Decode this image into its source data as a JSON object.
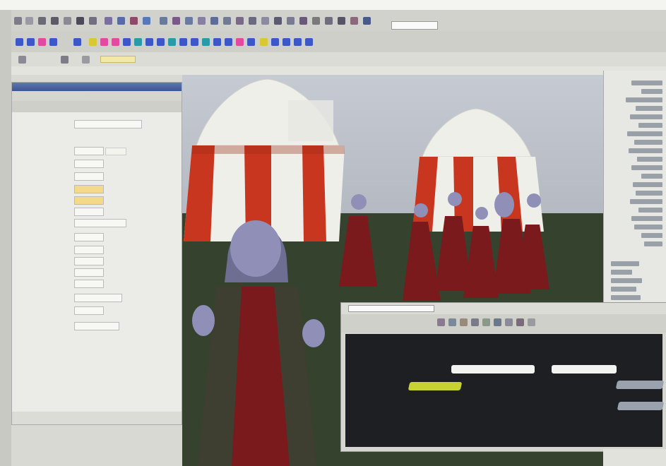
{
  "toolbar": {
    "icons": [
      "select-icon",
      "lasso-icon",
      "move-icon",
      "rotate-icon",
      "scale-icon",
      "soft-mod-icon",
      "show-manip-icon",
      "snap-grid-icon",
      "snap-curve-icon",
      "snap-point-icon",
      "snap-surface-icon",
      "history-icon",
      "render-icon",
      "ipr-icon",
      "render-settings-icon",
      "hypershade-icon"
    ],
    "shelf_icons": [
      "sphere-icon",
      "cube-icon",
      "cylinder-icon",
      "cone-icon",
      "plane-icon",
      "torus-icon",
      "nurbs-sphere-icon",
      "nurbs-cube-icon",
      "curve-icon",
      "paint-icon",
      "sculpt-icon",
      "joint-icon",
      "ik-icon",
      "skin-icon",
      "deformer-icon",
      "cloth-icon"
    ],
    "colors": {
      "shelf_blue": "#3c58c8",
      "shelf_pink": "#e24aa2",
      "shelf_teal": "#2b9aa8",
      "shelf_yellow": "#d9c833"
    }
  },
  "attribute_editor": {
    "accent": "#4a64a4",
    "rows": [
      {
        "label": "",
        "value": ""
      },
      {
        "label": "",
        "value": ""
      },
      {
        "label": "",
        "value": ""
      },
      {
        "label": "",
        "value": ""
      },
      {
        "label": "",
        "value": ""
      },
      {
        "label": "",
        "value": ""
      },
      {
        "label": "",
        "value": ""
      },
      {
        "label": "",
        "value": ""
      },
      {
        "label": "",
        "value": ""
      },
      {
        "label": "",
        "value": ""
      },
      {
        "label": "",
        "value": ""
      },
      {
        "label": "",
        "value": ""
      },
      {
        "label": "",
        "value": ""
      },
      {
        "label": "",
        "value": ""
      },
      {
        "label": "",
        "value": ""
      },
      {
        "label": "",
        "value": ""
      }
    ],
    "buttons": [
      "",
      "",
      "",
      ""
    ]
  },
  "viewport": {
    "colors": {
      "tent_red": "#c8361f",
      "tent_white": "#efefe9",
      "ground": "#35422d",
      "robe": "#7a1a1c",
      "helmet": "#8f8fb8"
    }
  },
  "hypergraph": {
    "colors": {
      "canvas": "#1e1f22",
      "node_white": "#f2f2f0",
      "node_yellow": "#c8d233",
      "node_grey": "#9aa3ad"
    },
    "nodes": [
      {
        "label": ""
      },
      {
        "label": ""
      },
      {
        "label": ""
      },
      {
        "label": ""
      },
      {
        "label": ""
      }
    ]
  }
}
